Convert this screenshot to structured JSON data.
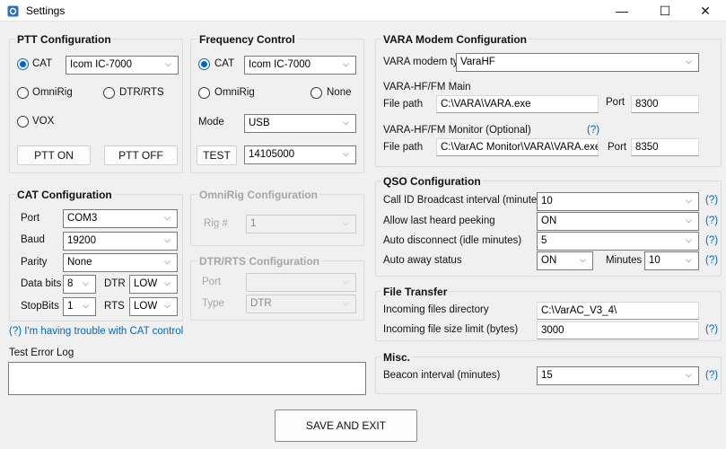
{
  "window": {
    "title": "Settings",
    "minimize": "—",
    "maximize": "☐",
    "close": "✕"
  },
  "ptt": {
    "title": "PTT Configuration",
    "cat_label": "CAT",
    "cat_radio": "Icom IC-7000",
    "omnirig_label": "OmniRig",
    "dtr_label": "DTR/RTS",
    "vox_label": "VOX",
    "ptt_on": "PTT ON",
    "ptt_off": "PTT OFF"
  },
  "freq": {
    "title": "Frequency Control",
    "cat_label": "CAT",
    "cat_radio": "Icom IC-7000",
    "omnirig_label": "OmniRig",
    "none_label": "None",
    "mode_label": "Mode",
    "mode_value": "USB",
    "test_label": "TEST",
    "freq_value": "14105000"
  },
  "cat": {
    "title": "CAT Configuration",
    "port_label": "Port",
    "port_value": "COM3",
    "baud_label": "Baud",
    "baud_value": "19200",
    "parity_label": "Parity",
    "parity_value": "None",
    "databits_label": "Data bits",
    "databits_value": "8",
    "dtr_label": "DTR",
    "dtr_value": "LOW",
    "stopbits_label": "StopBits",
    "stopbits_value": "1",
    "rts_label": "RTS",
    "rts_value": "LOW",
    "help_link": "(?) I'm having trouble with CAT control"
  },
  "omnirig": {
    "title": "OmniRig Configuration",
    "rig_label": "Rig #",
    "rig_value": "1"
  },
  "dtrrts": {
    "title": "DTR/RTS Configuration",
    "port_label": "Port",
    "port_value": "",
    "type_label": "Type",
    "type_value": "DTR"
  },
  "log": {
    "title": "Test Error Log",
    "value": ""
  },
  "vara": {
    "title": "VARA Modem Configuration",
    "type_label": "VARA modem type",
    "type_value": "VaraHF",
    "main_label": "VARA-HF/FM Main",
    "main_path_label": "File path",
    "main_path_value": "C:\\VARA\\VARA.exe",
    "main_port_label": "Port",
    "main_port_value": "8300",
    "monitor_label": "VARA-HF/FM Monitor (Optional)",
    "monitor_help": "(?)",
    "monitor_path_label": "File path",
    "monitor_path_value": "C:\\VarAC Monitor\\VARA\\VARA.exe",
    "monitor_port_label": "Port",
    "monitor_port_value": "8350"
  },
  "qso": {
    "title": "QSO Configuration",
    "callid_label": "Call ID Broadcast interval (minutes)",
    "callid_value": "10",
    "lastheard_label": "Allow last heard peeking",
    "lastheard_value": "ON",
    "autodisc_label": "Auto disconnect (idle minutes)",
    "autodisc_value": "5",
    "away_label": "Auto away status",
    "away_value": "ON",
    "minutes_label": "Minutes",
    "minutes_value": "10",
    "help": "(?)"
  },
  "transfer": {
    "title": "File Transfer",
    "dir_label": "Incoming files directory",
    "dir_value": "C:\\VarAC_V3_4\\",
    "limit_label": "Incoming file size limit (bytes)",
    "limit_value": "3000",
    "help": "(?)"
  },
  "misc": {
    "title": "Misc.",
    "beacon_label": "Beacon interval (minutes)",
    "beacon_value": "15",
    "help": "(?)"
  },
  "save_label": "SAVE AND EXIT",
  "colors": {
    "accent": "#0067c0",
    "background": "#f0f0f0",
    "disabled": "#a6a6a6"
  }
}
